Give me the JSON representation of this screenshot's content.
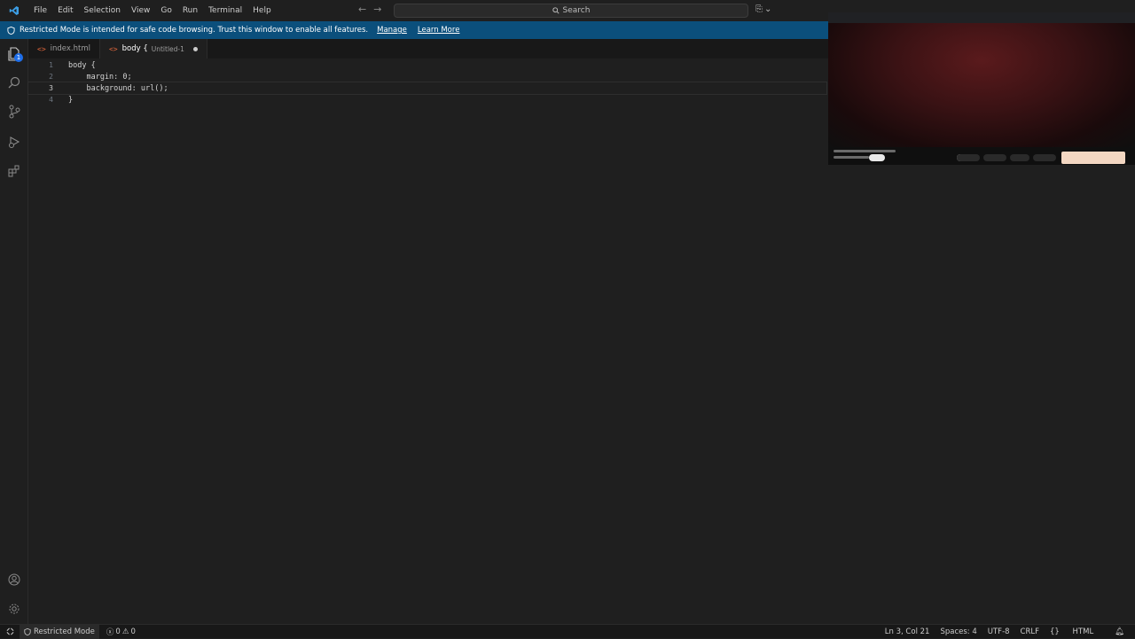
{
  "menu": [
    "File",
    "Edit",
    "Selection",
    "View",
    "Go",
    "Run",
    "Terminal",
    "Help"
  ],
  "search": {
    "label": "Search"
  },
  "banner": {
    "message": "Restricted Mode is intended for safe code browsing. Trust this window to enable all features.",
    "manage": "Manage",
    "learn_more": "Learn More"
  },
  "activity": {
    "explorer_badge": "1"
  },
  "tabs": [
    {
      "label": "index.html",
      "active": false
    },
    {
      "label": "body {",
      "sub": "Untitled-1",
      "active": true,
      "modified": true
    }
  ],
  "editor": {
    "lines": [
      {
        "num": "1",
        "text": "body {"
      },
      {
        "num": "2",
        "text": "    margin: 0;"
      },
      {
        "num": "3",
        "text": "    background: url();"
      },
      {
        "num": "4",
        "text": "}"
      }
    ],
    "current_line": 3
  },
  "statusbar": {
    "restricted": "Restricted Mode",
    "errors": "0",
    "warnings": "0",
    "position": "Ln 3, Col 21",
    "spaces": "Spaces: 4",
    "encoding": "UTF-8",
    "eol": "CRLF",
    "language": "HTML"
  },
  "colors": {
    "accent": "#0b4f7c",
    "background": "#1f1f1f",
    "badge": "#1f6feb",
    "html_icon": "#e0673c"
  }
}
